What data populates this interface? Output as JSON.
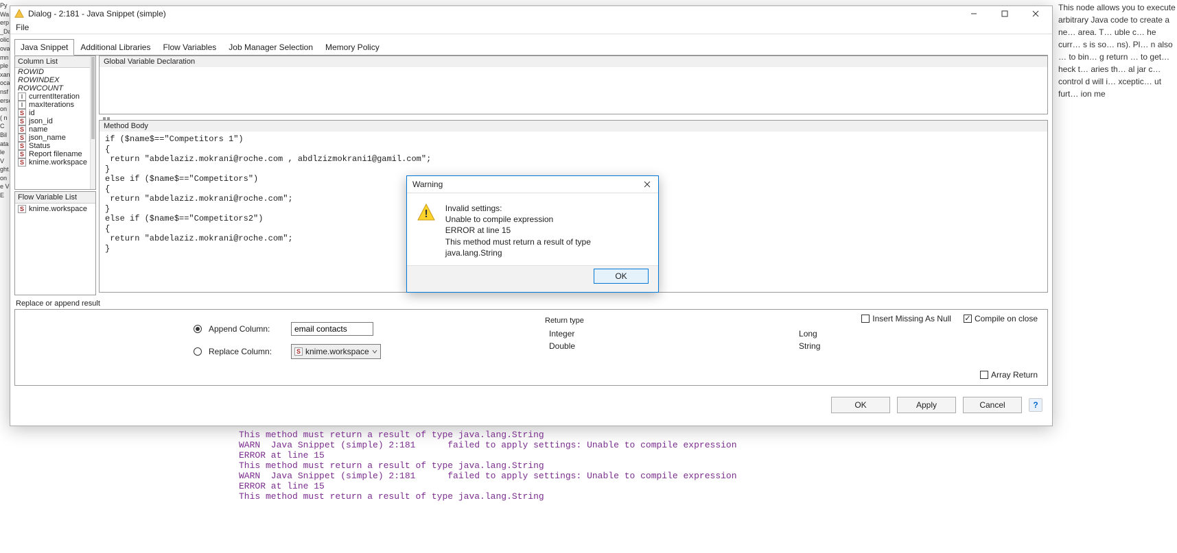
{
  "bg_right_text": "This node allows you to execute arbitrary Java code to create a ne… area. T… uble c… he curr… s is so… ns). Pl… n also … to bin… g return …\n\nto get… heck t…\n\naries th… al jar c… control\n\nd will i… xceptic… ut furt… ion me",
  "window": {
    "title": "Dialog - 2:181 - Java Snippet (simple)"
  },
  "menubar": {
    "file": "File"
  },
  "tabs": [
    "Java Snippet",
    "Additional Libraries",
    "Flow Variables",
    "Job Manager Selection",
    "Memory Policy"
  ],
  "column_list": {
    "title": "Column List",
    "items": [
      {
        "label": "ROWID",
        "italic": true
      },
      {
        "label": "ROWINDEX",
        "italic": true
      },
      {
        "label": "ROWCOUNT",
        "italic": true
      },
      {
        "type": "I",
        "label": "currentIteration"
      },
      {
        "type": "I",
        "label": "maxIterations"
      },
      {
        "type": "S",
        "label": "id"
      },
      {
        "type": "S",
        "label": "json_id"
      },
      {
        "type": "S",
        "label": "name"
      },
      {
        "type": "S",
        "label": "json_name"
      },
      {
        "type": "S",
        "label": "Status"
      },
      {
        "type": "S",
        "label": "Report filename"
      },
      {
        "type": "S",
        "label": "knime.workspace"
      }
    ]
  },
  "flow_var_list": {
    "title": "Flow Variable List",
    "items": [
      {
        "type": "S",
        "label": "knime.workspace"
      }
    ]
  },
  "gvd_title": "Global Variable Declaration",
  "method_body_title": "Method Body",
  "method_body_code": "if ($name$==\"Competitors 1\")\n{\n return \"abdelaziz.mokrani@roche.com , abdlzizmokrani1@gamil.com\";\n}\nelse if ($name$==\"Competitors\")\n{\n return \"abdelaziz.mokrani@roche.com\";\n}\nelse if ($name$==\"Competitors2\")\n{\n return \"abdelaziz.mokrani@roche.com\";\n}",
  "replace_append_title": "Replace or append result",
  "append_column_label": "Append Column:",
  "append_column_value": "email contacts",
  "replace_column_label": "Replace Column:",
  "replace_column_value": "knime.workspace",
  "insert_missing_label": "Insert Missing As Null",
  "compile_on_close_label": "Compile on close",
  "return_type_title": "Return type",
  "return_types": {
    "integer": "Integer",
    "long": "Long",
    "double": "Double",
    "string": "String"
  },
  "array_return_label": "Array Return",
  "buttons": {
    "ok": "OK",
    "apply": "Apply",
    "cancel": "Cancel"
  },
  "warning": {
    "title": "Warning",
    "line1": "Invalid settings:",
    "line2": "Unable to compile expression",
    "line3": "ERROR at line 15",
    "line4": "This method must return a result of type java.lang.String",
    "ok": "OK"
  },
  "console_lines": [
    {
      "cls": "purple",
      "t": "This method must return a result of type java.lang.String"
    },
    {
      "cls": "purple",
      "t": "WARN  Java Snippet (simple) 2:181      failed to apply settings: Unable to compile expression"
    },
    {
      "cls": "purple",
      "t": "ERROR at line 15"
    },
    {
      "cls": "purple",
      "t": "This method must return a result of type java.lang.String"
    },
    {
      "cls": "purple",
      "t": "WARN  Java Snippet (simple) 2:181      failed to apply settings: Unable to compile expression"
    },
    {
      "cls": "purple",
      "t": "ERROR at line 15"
    },
    {
      "cls": "purple",
      "t": "This method must return a result of type java.lang.String"
    }
  ],
  "edge_fragments": "Py\nWa\nerp\n_Da\nolic\nova\nmn\nple\nxan\noca\nnsf\nerso\non (\nn C\nBil\nata\nle V\nght…\n\non\ne V\nE"
}
